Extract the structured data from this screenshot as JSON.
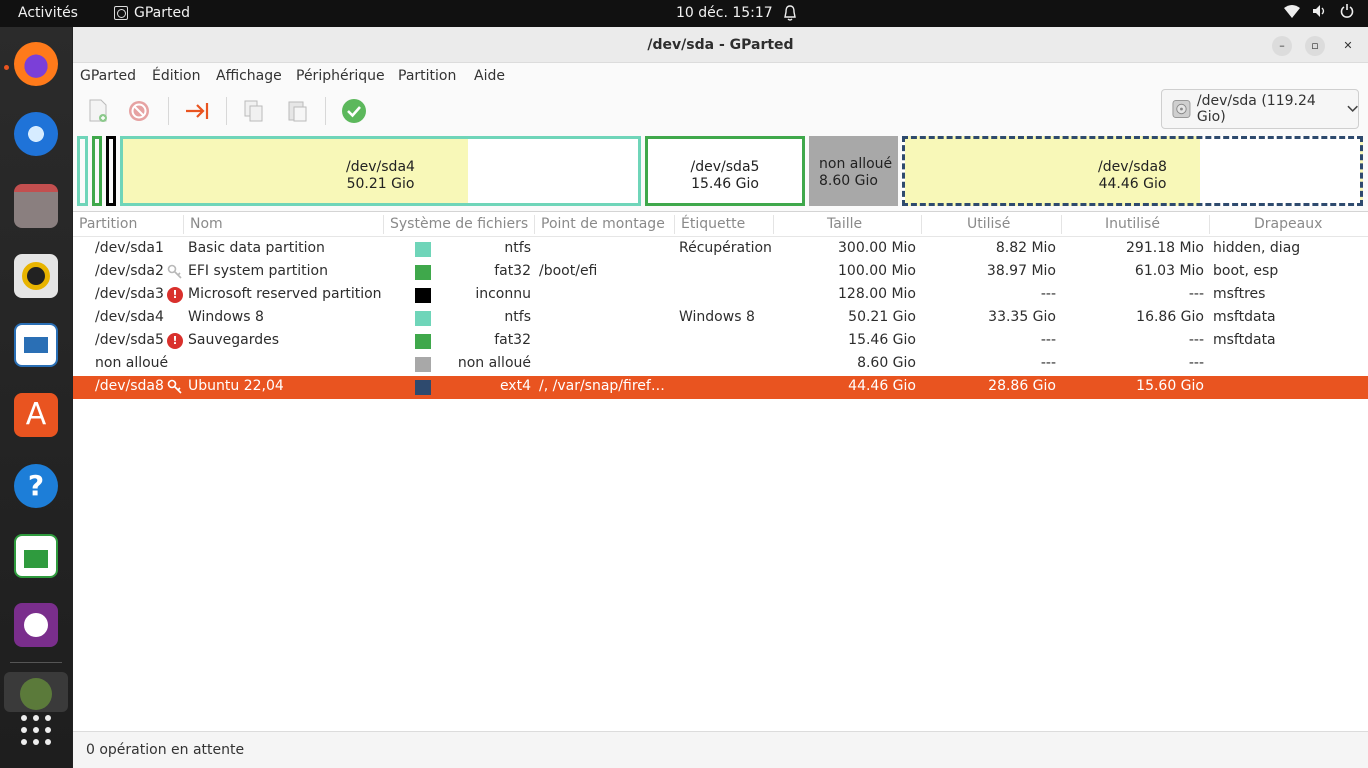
{
  "topbar": {
    "activities": "Activités",
    "app_name": "GParted",
    "clock": "10 déc.  15:17"
  },
  "dock": {
    "items": [
      "firefox-icon",
      "thunderbird-icon",
      "files-icon",
      "rhythmbox-icon",
      "writer-icon",
      "app-center-icon",
      "help-icon",
      "calc-icon",
      "keepass-icon",
      "gparted-icon",
      "app-grid-icon"
    ]
  },
  "window": {
    "title": "/dev/sda - GParted",
    "menu": [
      "GParted",
      "Édition",
      "Affichage",
      "Périphérique",
      "Partition",
      "Aide"
    ],
    "device_selector": "/dev/sda (119.24 Gio)"
  },
  "graphic": {
    "segments": [
      {
        "name": "/dev/sda4",
        "size": "50.21 Gio"
      },
      {
        "name": "/dev/sda5",
        "size": "15.46 Gio"
      },
      {
        "name": "non alloué",
        "size": "8.60 Gio"
      },
      {
        "name": "/dev/sda8",
        "size": "44.46 Gio"
      }
    ]
  },
  "table": {
    "headers": [
      "Partition",
      "Nom",
      "Système de fichiers",
      "Point de montage",
      "Étiquette",
      "Taille",
      "Utilisé",
      "Inutilisé",
      "Drapeaux"
    ],
    "rows": [
      {
        "partition": "/dev/sda1",
        "nom": "Basic data partition",
        "fs": "ntfs",
        "fs_color": "#6fd5b9",
        "mount": "",
        "label": "Récupération",
        "taille": "300.00 Mio",
        "utilise": "8.82 Mio",
        "inutilise": "291.18 Mio",
        "flags": "hidden, diag",
        "status": "none"
      },
      {
        "partition": "/dev/sda2",
        "nom": "EFI system partition",
        "fs": "fat32",
        "fs_color": "#3fa84b",
        "mount": "/boot/efi",
        "label": "",
        "taille": "100.00 Mio",
        "utilise": "38.97 Mio",
        "inutilise": "61.03 Mio",
        "flags": "boot, esp",
        "status": "key"
      },
      {
        "partition": "/dev/sda3",
        "nom": "Microsoft reserved partition",
        "fs": "inconnu",
        "fs_color": "#000000",
        "mount": "",
        "label": "",
        "taille": "128.00 Mio",
        "utilise": "---",
        "inutilise": "---",
        "flags": "msftres",
        "status": "warn"
      },
      {
        "partition": "/dev/sda4",
        "nom": "Windows 8",
        "fs": "ntfs",
        "fs_color": "#6fd5b9",
        "mount": "",
        "label": "Windows 8",
        "taille": "50.21 Gio",
        "utilise": "33.35 Gio",
        "inutilise": "16.86 Gio",
        "flags": "msftdata",
        "status": "none"
      },
      {
        "partition": "/dev/sda5",
        "nom": "Sauvegardes",
        "fs": "fat32",
        "fs_color": "#3fa84b",
        "mount": "",
        "label": "",
        "taille": "15.46 Gio",
        "utilise": "---",
        "inutilise": "---",
        "flags": "msftdata",
        "status": "warn"
      },
      {
        "partition": "non alloué",
        "nom": "",
        "fs": "non alloué",
        "fs_color": "#a8a8a8",
        "mount": "",
        "label": "",
        "taille": "8.60 Gio",
        "utilise": "---",
        "inutilise": "---",
        "flags": "",
        "status": "none"
      },
      {
        "partition": "/dev/sda8",
        "nom": "Ubuntu 22,04",
        "fs": "ext4",
        "fs_color": "#2e4a6e",
        "mount": "/, /var/snap/firef…",
        "label": "",
        "taille": "44.46 Gio",
        "utilise": "28.86 Gio",
        "inutilise": "15.60 Gio",
        "flags": "",
        "status": "key"
      }
    ]
  },
  "statusbar": "0 opération en attente",
  "colors": {
    "accent": "#e95420",
    "ntfs": "#6fd5b9",
    "fat32": "#3fa84b",
    "ext4": "#2e4a6e",
    "unallocated": "#a8a8a8",
    "used_fill": "#f8f8b8"
  }
}
